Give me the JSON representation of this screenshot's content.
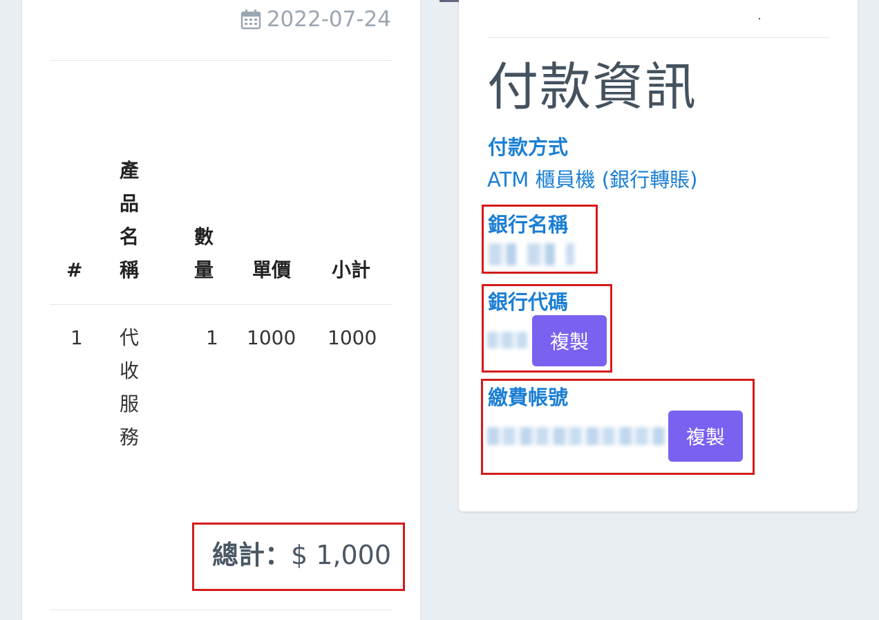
{
  "invoice": {
    "date": "2022-07-24",
    "table": {
      "headers": [
        "#",
        "產品名稱",
        "數量",
        "單價",
        "小計"
      ],
      "rows": [
        [
          "1",
          "代收服務",
          "1",
          "1000",
          "1000"
        ]
      ]
    },
    "total_label": "總計：",
    "total_value": "$ 1,000"
  },
  "payment": {
    "title": "付款資訊",
    "method_label": "付款方式",
    "method_value": "ATM 櫃員機 (銀行轉賬)",
    "bank_name_label": "銀行名稱",
    "bank_code_label": "銀行代碼",
    "account_label": "繳費帳號",
    "copy_label": "複製"
  },
  "colors": {
    "accent_blue": "#1a7ed4",
    "button_purple": "#7b61f0",
    "highlight_red": "#d51a1a"
  }
}
